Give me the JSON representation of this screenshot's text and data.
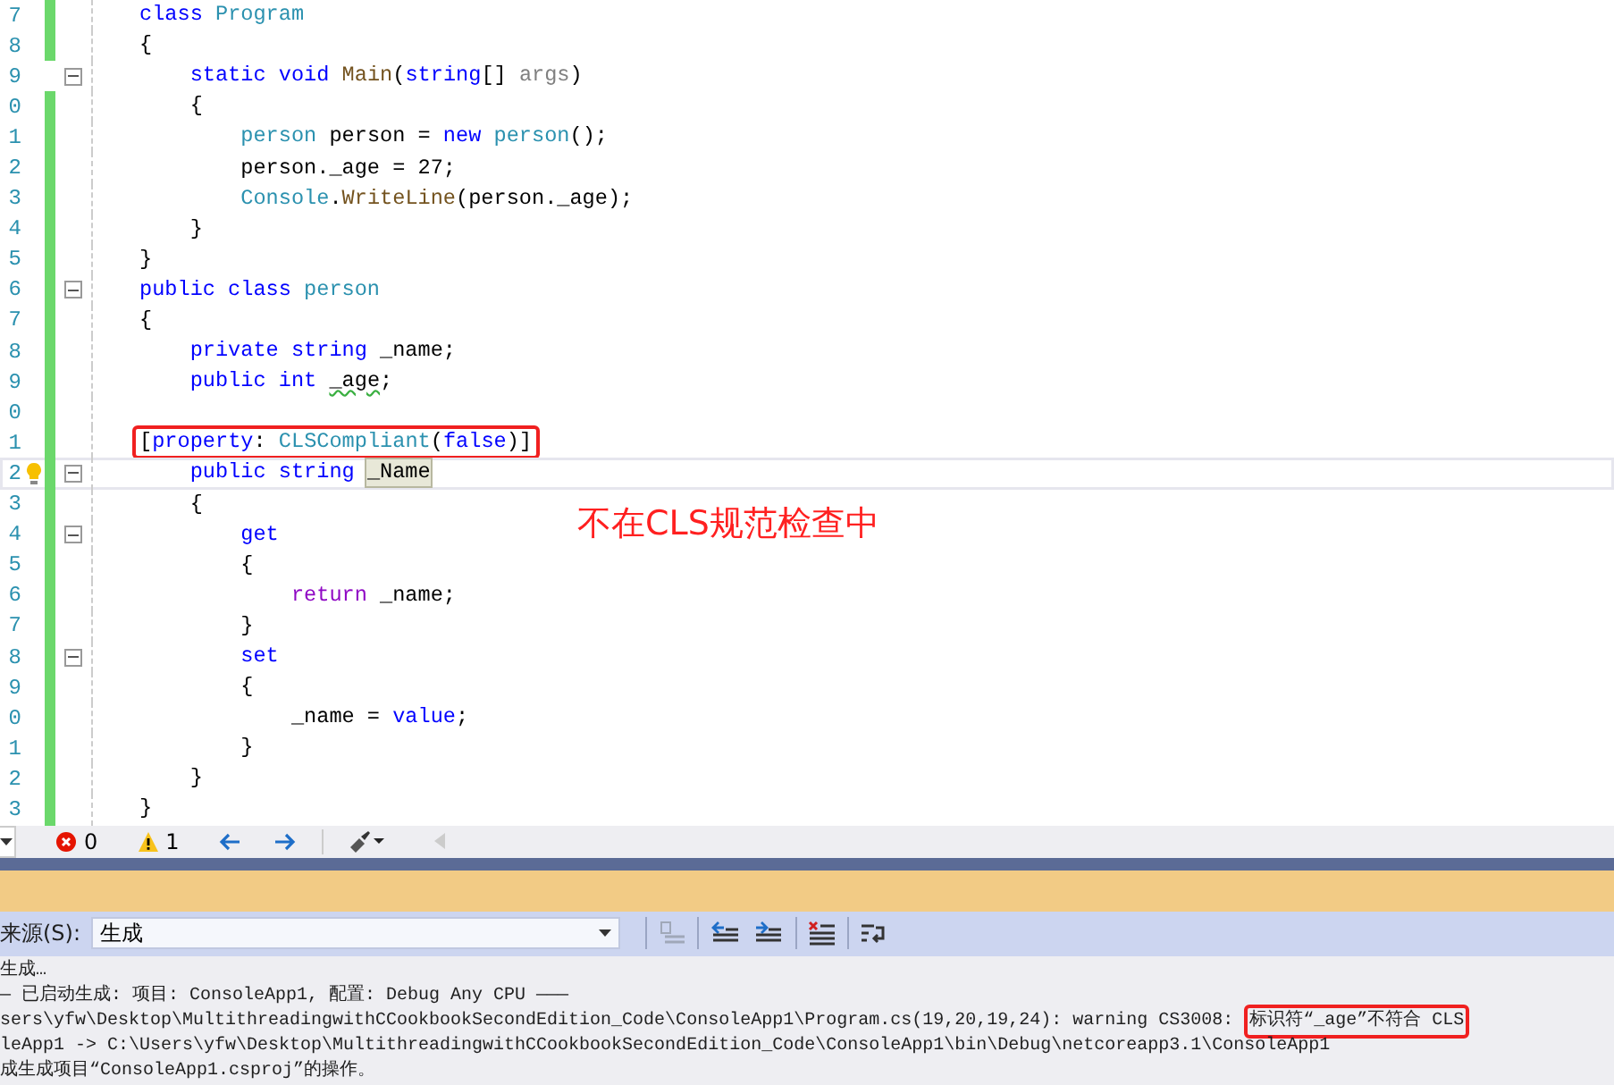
{
  "editor": {
    "lines": [
      {
        "number": "7",
        "changed": true,
        "foldable": false,
        "current": false,
        "boxed": false,
        "lightbulb": false,
        "tokens": [
          {
            "text": "class ",
            "kind": "kw"
          },
          {
            "text": "Program",
            "kind": "type"
          }
        ]
      },
      {
        "number": "8",
        "changed": true,
        "foldable": false,
        "current": false,
        "boxed": false,
        "lightbulb": false,
        "tokens": [
          {
            "text": "{",
            "kind": "plain"
          }
        ]
      },
      {
        "number": "9",
        "changed": false,
        "foldable": true,
        "current": false,
        "boxed": false,
        "lightbulb": false,
        "tokens": [
          {
            "text": "    static void ",
            "kind": "kw"
          },
          {
            "text": "Main",
            "kind": "method"
          },
          {
            "text": "(",
            "kind": "plain"
          },
          {
            "text": "string",
            "kind": "kw"
          },
          {
            "text": "[] ",
            "kind": "plain"
          },
          {
            "text": "args",
            "kind": "param"
          },
          {
            "text": ")",
            "kind": "plain"
          }
        ]
      },
      {
        "number": "0",
        "changed": true,
        "foldable": false,
        "current": false,
        "boxed": false,
        "lightbulb": false,
        "tokens": [
          {
            "text": "    {",
            "kind": "plain"
          }
        ]
      },
      {
        "number": "1",
        "changed": true,
        "foldable": false,
        "current": false,
        "boxed": false,
        "lightbulb": false,
        "tokens": [
          {
            "text": "        person",
            "kind": "type"
          },
          {
            "text": " person = ",
            "kind": "plain"
          },
          {
            "text": "new ",
            "kind": "kw"
          },
          {
            "text": "person",
            "kind": "type"
          },
          {
            "text": "();",
            "kind": "plain"
          }
        ]
      },
      {
        "number": "2",
        "changed": true,
        "foldable": false,
        "current": false,
        "boxed": false,
        "lightbulb": false,
        "tokens": [
          {
            "text": "        person._age = 27;",
            "kind": "plain"
          }
        ]
      },
      {
        "number": "3",
        "changed": true,
        "foldable": false,
        "current": false,
        "boxed": false,
        "lightbulb": false,
        "tokens": [
          {
            "text": "        Console",
            "kind": "type"
          },
          {
            "text": ".",
            "kind": "plain"
          },
          {
            "text": "WriteLine",
            "kind": "method"
          },
          {
            "text": "(person._age);",
            "kind": "plain"
          }
        ]
      },
      {
        "number": "4",
        "changed": true,
        "foldable": false,
        "current": false,
        "boxed": false,
        "lightbulb": false,
        "tokens": [
          {
            "text": "    }",
            "kind": "plain"
          }
        ]
      },
      {
        "number": "5",
        "changed": true,
        "foldable": false,
        "current": false,
        "boxed": false,
        "lightbulb": false,
        "tokens": [
          {
            "text": "}",
            "kind": "plain"
          }
        ]
      },
      {
        "number": "6",
        "changed": true,
        "foldable": true,
        "current": false,
        "boxed": false,
        "lightbulb": false,
        "tokens": [
          {
            "text": "public class ",
            "kind": "kw"
          },
          {
            "text": "person",
            "kind": "type"
          }
        ]
      },
      {
        "number": "7",
        "changed": true,
        "foldable": false,
        "current": false,
        "boxed": false,
        "lightbulb": false,
        "tokens": [
          {
            "text": "{",
            "kind": "plain"
          }
        ]
      },
      {
        "number": "8",
        "changed": true,
        "foldable": false,
        "current": false,
        "boxed": false,
        "lightbulb": false,
        "tokens": [
          {
            "text": "    private string",
            "kind": "kw"
          },
          {
            "text": " _name;",
            "kind": "plain"
          }
        ]
      },
      {
        "number": "9",
        "changed": true,
        "foldable": false,
        "current": false,
        "boxed": false,
        "lightbulb": false,
        "tokens": [
          {
            "text": "    public int ",
            "kind": "kw"
          },
          {
            "text": "_age",
            "kind": "warned"
          },
          {
            "text": ";",
            "kind": "plain"
          }
        ]
      },
      {
        "number": "0",
        "changed": true,
        "foldable": false,
        "current": false,
        "boxed": false,
        "lightbulb": false
      },
      {
        "number": "1",
        "changed": true,
        "foldable": false,
        "current": false,
        "boxed": true,
        "lightbulb": false,
        "tokens": [
          {
            "text": "[",
            "kind": "plain"
          },
          {
            "text": "property",
            "kind": "kw"
          },
          {
            "text": ": ",
            "kind": "plain"
          },
          {
            "text": "CLSCompliant",
            "kind": "type"
          },
          {
            "text": "(",
            "kind": "plain"
          },
          {
            "text": "false",
            "kind": "kw"
          },
          {
            "text": ")]",
            "kind": "plain"
          }
        ]
      },
      {
        "number": "2",
        "changed": true,
        "foldable": true,
        "current": true,
        "boxed": false,
        "lightbulb": true,
        "tokens": [
          {
            "text": "    public string ",
            "kind": "kw"
          },
          {
            "text": "_Name",
            "kind": "highlighted"
          }
        ]
      },
      {
        "number": "3",
        "changed": true,
        "foldable": false,
        "current": false,
        "boxed": false,
        "lightbulb": false,
        "tokens": [
          {
            "text": "    {",
            "kind": "plain"
          }
        ]
      },
      {
        "number": "4",
        "changed": true,
        "foldable": true,
        "current": false,
        "boxed": false,
        "lightbulb": false,
        "tokens": [
          {
            "text": "        get",
            "kind": "kw"
          }
        ]
      },
      {
        "number": "5",
        "changed": true,
        "foldable": false,
        "current": false,
        "boxed": false,
        "lightbulb": false,
        "tokens": [
          {
            "text": "        {",
            "kind": "plain"
          }
        ]
      },
      {
        "number": "6",
        "changed": true,
        "foldable": false,
        "current": false,
        "boxed": false,
        "lightbulb": false,
        "tokens": [
          {
            "text": "            return",
            "kind": "ctl"
          },
          {
            "text": " _name;",
            "kind": "plain"
          }
        ]
      },
      {
        "number": "7",
        "changed": true,
        "foldable": false,
        "current": false,
        "boxed": false,
        "lightbulb": false,
        "tokens": [
          {
            "text": "        }",
            "kind": "plain"
          }
        ]
      },
      {
        "number": "8",
        "changed": true,
        "foldable": true,
        "current": false,
        "boxed": false,
        "lightbulb": false,
        "tokens": [
          {
            "text": "        set",
            "kind": "kw"
          }
        ]
      },
      {
        "number": "9",
        "changed": true,
        "foldable": false,
        "current": false,
        "boxed": false,
        "lightbulb": false,
        "tokens": [
          {
            "text": "        {",
            "kind": "plain"
          }
        ]
      },
      {
        "number": "0",
        "changed": true,
        "foldable": false,
        "current": false,
        "boxed": false,
        "lightbulb": false,
        "tokens": [
          {
            "text": "            _name = ",
            "kind": "plain"
          },
          {
            "text": "value",
            "kind": "kw"
          },
          {
            "text": ";",
            "kind": "plain"
          }
        ]
      },
      {
        "number": "1",
        "changed": true,
        "foldable": false,
        "current": false,
        "boxed": false,
        "lightbulb": false,
        "tokens": [
          {
            "text": "        }",
            "kind": "plain"
          }
        ]
      },
      {
        "number": "2",
        "changed": true,
        "foldable": false,
        "current": false,
        "boxed": false,
        "lightbulb": false,
        "tokens": [
          {
            "text": "    }",
            "kind": "plain"
          }
        ]
      },
      {
        "number": "3",
        "changed": true,
        "foldable": false,
        "current": false,
        "boxed": false,
        "lightbulb": false,
        "tokens": [
          {
            "text": "}",
            "kind": "plain"
          }
        ]
      }
    ],
    "annotation": "不在CLS规范检查中"
  },
  "status_bar": {
    "errors": "0",
    "warnings": "1"
  },
  "output": {
    "source_label": "来源(S):",
    "source_value": "生成",
    "lines": [
      {
        "segments": [
          {
            "text": "生成…",
            "boxed": false
          }
        ]
      },
      {
        "segments": [
          {
            "text": "— 已启动生成: 项目: ConsoleApp1, 配置: Debug Any CPU ———",
            "boxed": false
          }
        ]
      },
      {
        "segments": [
          {
            "text": "sers\\yfw\\Desktop\\MultithreadingwithCCookbookSecondEdition_Code\\ConsoleApp1\\Program.cs(19,20,19,24): warning CS3008: ",
            "boxed": false
          },
          {
            "text": "标识符“_age”不符合 CLS",
            "boxed": true
          }
        ]
      },
      {
        "segments": [
          {
            "text": "leApp1 -> C:\\Users\\yfw\\Desktop\\MultithreadingwithCCookbookSecondEdition_Code\\ConsoleApp1\\bin\\Debug\\netcoreapp3.1\\ConsoleApp1",
            "boxed": false
          }
        ]
      },
      {
        "segments": [
          {
            "text": "成生成项目“ConsoleApp1.csproj”的操作。",
            "boxed": false
          }
        ]
      }
    ]
  }
}
